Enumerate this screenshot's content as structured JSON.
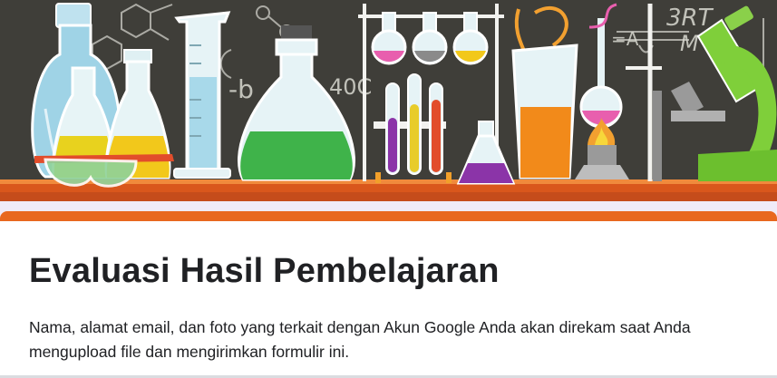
{
  "form": {
    "title": "Evaluasi Hasil Pembelajaran",
    "description": "Nama, alamat email, dan foto yang terkait dengan Akun Google Anda akan direkam saat Anda mengupload file dan mengirimkan formulir ini."
  },
  "banner": {
    "icon": "chemistry-lab-illustration",
    "chalk_text": [
      "3RT",
      "M",
      "-b",
      "40C",
      "=A"
    ]
  },
  "colors": {
    "accent": "#e8681f",
    "chalkboard": "#3b3a36",
    "shelf": "#d9571c",
    "text": "#202124"
  }
}
